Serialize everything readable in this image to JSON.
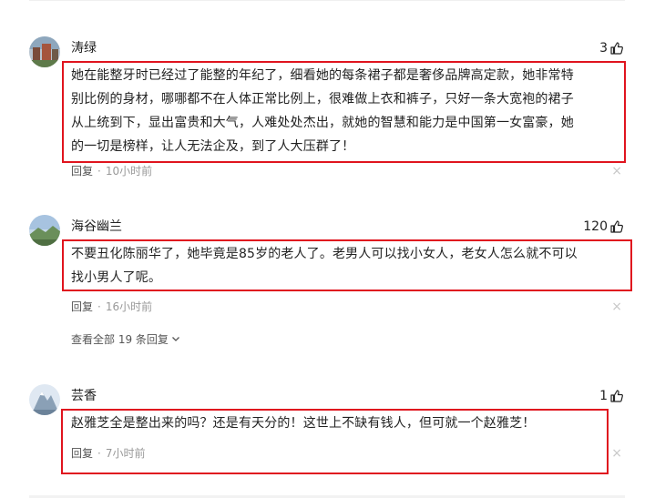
{
  "comments": [
    {
      "username": "涛绿",
      "likes": "3",
      "text_lines": [
        "她在能整牙时已经过了能整的年纪了，细看她的每条裙子都是奢侈品牌高定款，她非常特",
        "别比例的身材，哪哪都不在人体正常比例上，很难做上衣和裤子，只好一条大宽袍的裙子",
        "从上统到下，显出富贵和大气，人难处处杰出，就她的智慧和能力是中国第一女富豪，她",
        "的一切是榜样，让人无法企及，到了人大压群了！"
      ],
      "reply_label": "回复",
      "time": "10小时前",
      "close_glyph": "×"
    },
    {
      "username": "海谷幽兰",
      "likes": "120",
      "text_lines": [
        "不要丑化陈丽华了，她毕竟是85岁的老人了。老男人可以找小女人，老女人怎么就不可以",
        "找小男人了呢。"
      ],
      "reply_label": "回复",
      "time": "16小时前",
      "close_glyph": "×",
      "view_all_label": "查看全部 19 条回复"
    },
    {
      "username": "芸香",
      "likes": "1",
      "text_lines": [
        "赵雅芝全是整出来的吗？还是有天分的！这世上不缺有钱人，但可就一个赵雅芝！"
      ],
      "reply_label": "回复",
      "time": "7小时前",
      "close_glyph": "×"
    }
  ],
  "meta_separator": "·",
  "icons": {
    "like": "thumbs-up-icon",
    "expand": "chevron-down-icon",
    "close": "close-icon"
  },
  "colors": {
    "highlight_border": "#e0141e",
    "meta_text": "#999999",
    "primary_text": "#222222"
  }
}
